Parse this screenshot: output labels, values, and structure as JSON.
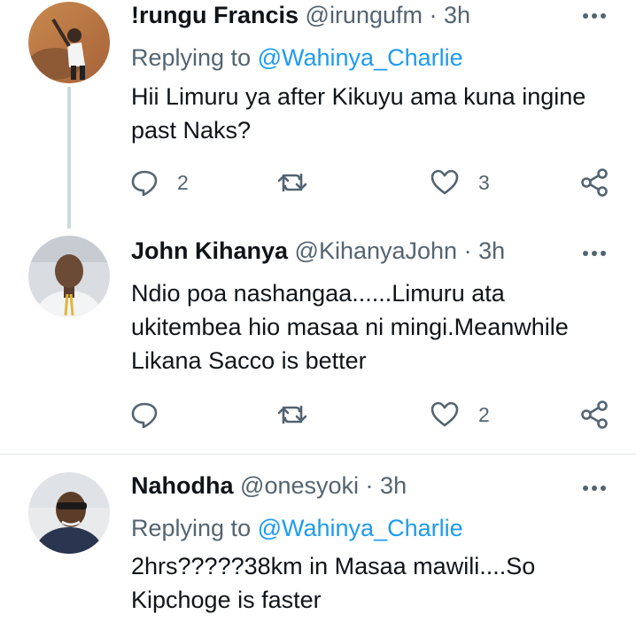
{
  "tweets": [
    {
      "name": "!rungu Francis",
      "handle": "@irungufm",
      "separator": "·",
      "time": "3h",
      "replying_prefix": "Replying to",
      "replying_to": "@Wahinya_Charlie",
      "text_lines": [
        "Hii Limuru ya after Kikuyu ama kuna ingine",
        "past Naks?"
      ],
      "reply_count": "2",
      "retweet_count": "",
      "like_count": "3"
    },
    {
      "name": "John Kihanya",
      "handle": "@KihanyaJohn",
      "separator": "·",
      "time": "3h",
      "text_lines": [
        "Ndio poa nashangaa......Limuru ata",
        "ukitembea hio masaa ni mingi.Meanwhile",
        "Likana Sacco is better"
      ],
      "reply_count": "",
      "retweet_count": "",
      "like_count": "2"
    },
    {
      "name": "Nahodha",
      "handle": "@onesyoki",
      "separator": "·",
      "time": "3h",
      "replying_prefix": "Replying to",
      "replying_to": "@Wahinya_Charlie",
      "text_lines": [
        "2hrs?????38km in Masaa mawili....So",
        "Kipchoge is faster"
      ]
    }
  ],
  "colors": {
    "text": "#0f1419",
    "secondary": "#536471",
    "link": "#1d9bf0",
    "thread_line": "#cfd9de"
  },
  "icons": [
    "more-icon",
    "reply-icon",
    "retweet-icon",
    "like-icon",
    "share-icon"
  ]
}
